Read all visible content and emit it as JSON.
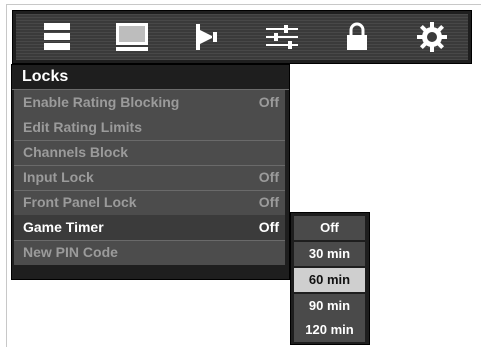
{
  "tabs": [
    {
      "icon": "list-icon"
    },
    {
      "icon": "monitor-icon"
    },
    {
      "icon": "speaker-icon"
    },
    {
      "icon": "sliders-icon"
    },
    {
      "icon": "lock-icon"
    },
    {
      "icon": "gear-icon"
    }
  ],
  "menu": {
    "title": "Locks",
    "items": [
      {
        "label": "Enable Rating Blocking",
        "value": "Off",
        "enabled": false
      },
      {
        "label": "Edit Rating Limits",
        "value": "",
        "enabled": false
      },
      {
        "label": "Channels Block",
        "value": "",
        "enabled": false
      },
      {
        "label": "Input Lock",
        "value": "Off",
        "enabled": false
      },
      {
        "label": "Front Panel Lock",
        "value": "Off",
        "enabled": false
      },
      {
        "label": "Game Timer",
        "value": "Off",
        "enabled": true,
        "selected": true
      },
      {
        "label": "New PIN Code",
        "value": "",
        "enabled": false
      }
    ]
  },
  "dropdown": {
    "options": [
      "Off",
      "30 min",
      "60 min",
      "90 min",
      "120 min"
    ],
    "highlighted": "60 min"
  },
  "colors": {
    "panel": "#1e1e1e",
    "body": "#4c4c4c",
    "highlight": "#cfcfcf",
    "disabled_text": "#9b9b9b"
  }
}
